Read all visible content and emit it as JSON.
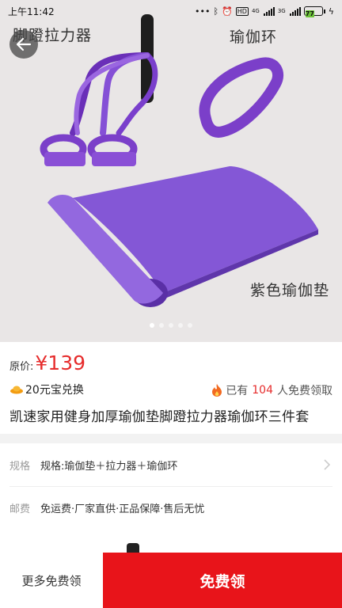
{
  "status_bar": {
    "time": "上午11:42",
    "battery": "77",
    "network_1": "4G",
    "network_2": "3G"
  },
  "hero": {
    "labels": [
      "脚蹬拉力器",
      "瑜伽环",
      "紫色瑜伽垫"
    ],
    "page_count": 5,
    "active_index": 0,
    "product_color": "#7b3fc9"
  },
  "product": {
    "original_price_label": "原价:",
    "price": "¥139",
    "coin_exchange": "20元宝兑换",
    "claimed_prefix": "已有",
    "claimed_count": "104",
    "claimed_suffix": "人免费领取",
    "title": "凯速家用健身加厚瑜伽垫脚蹬拉力器瑜伽环三件套"
  },
  "spec": {
    "rows": [
      {
        "key": "规格",
        "value": "规格:瑜伽垫＋拉力器＋瑜伽环"
      },
      {
        "key": "邮费",
        "value": "免运费·厂家直供·正品保障·售后无忧"
      }
    ]
  },
  "bottom_bar": {
    "more_label": "更多免费领",
    "free_label": "免费领"
  },
  "colors": {
    "accent_red": "#e8141a",
    "price_red": "#e62c2c",
    "hero_bg": "#e9e6e6"
  }
}
